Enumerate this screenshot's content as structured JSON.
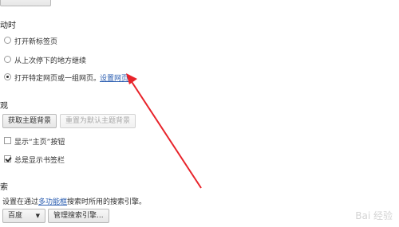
{
  "startup": {
    "heading": "动时",
    "options": [
      {
        "label": "打开新标签页",
        "checked": false
      },
      {
        "label": "从上次停下的地方继续",
        "checked": false
      },
      {
        "label": "打开特定网页或一组网页。",
        "checked": true
      }
    ],
    "set_pages_link": "设置网页"
  },
  "appearance": {
    "heading": "观",
    "get_theme_button": "获取主题背景",
    "reset_theme_button": "重置为默认主题背景",
    "show_home_label": "显示“主页”按钮",
    "show_home_checked": false,
    "show_bookmarks_label": "总是显示书签栏",
    "show_bookmarks_checked": true
  },
  "search": {
    "heading": "索",
    "desc_prefix": "设置在通过",
    "desc_link": "多功能框",
    "desc_suffix": "搜索时所用的搜索引擎。",
    "engine_value": "百度",
    "manage_button": "管理搜索引擎..."
  },
  "annotation": {
    "arrow_color": "#e8232a"
  },
  "watermark": "Bai 经验"
}
